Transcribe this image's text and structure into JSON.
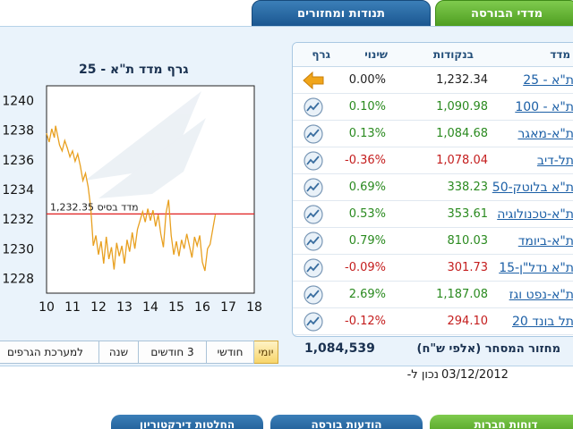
{
  "tabs": {
    "indices": "מדדי הבורסה",
    "movements": "תנודות ומחזורים"
  },
  "chart": {
    "title": "גרף מדד ת\"א - 25",
    "base_label": "מדד בסיס 1,232.35"
  },
  "chart_data": {
    "type": "line",
    "title": "גרף מדד ת\"א - 25",
    "x_ticks": [
      10,
      11,
      12,
      13,
      14,
      15,
      16,
      17,
      18
    ],
    "y_ticks": [
      1228,
      1230,
      1232,
      1234,
      1236,
      1238,
      1240
    ],
    "ylim": [
      1227,
      1241
    ],
    "xlim": [
      10,
      18
    ],
    "base_value": 1232.35,
    "series": [
      {
        "x": [
          10.0,
          10.1,
          10.2,
          10.3,
          10.35,
          10.5,
          10.6,
          10.7,
          10.8,
          10.9,
          11.0,
          11.1,
          11.2,
          11.3,
          11.4,
          11.5,
          11.6,
          11.7,
          11.8,
          11.9,
          12.0,
          12.1,
          12.2,
          12.3,
          12.4,
          12.5,
          12.6,
          12.7,
          12.8,
          12.9,
          13.0,
          13.1,
          13.2,
          13.3,
          13.4,
          13.5,
          13.6,
          13.7,
          13.8,
          13.9,
          14.0,
          14.1,
          14.2,
          14.3,
          14.4,
          14.5,
          14.6,
          14.7,
          14.8,
          14.9,
          15.0,
          15.1,
          15.2,
          15.3,
          15.4,
          15.5,
          15.6,
          15.7,
          15.8,
          15.9,
          16.0,
          16.1,
          16.2,
          16.3,
          16.4,
          16.5
        ],
        "values": [
          1237.8,
          1237.2,
          1238.1,
          1237.5,
          1238.3,
          1237.0,
          1236.6,
          1237.3,
          1236.8,
          1236.2,
          1236.6,
          1235.9,
          1236.4,
          1235.6,
          1234.6,
          1235.1,
          1234.2,
          1232.8,
          1230.2,
          1230.9,
          1229.6,
          1230.5,
          1229.0,
          1230.8,
          1229.3,
          1230.1,
          1228.6,
          1230.4,
          1229.5,
          1230.2,
          1229.0,
          1230.6,
          1229.8,
          1231.1,
          1230.0,
          1231.3,
          1231.9,
          1232.5,
          1231.8,
          1232.7,
          1231.9,
          1232.6,
          1231.5,
          1232.3,
          1231.0,
          1230.1,
          1232.4,
          1233.3,
          1230.9,
          1229.6,
          1230.5,
          1229.5,
          1230.6,
          1230.0,
          1231.0,
          1230.2,
          1229.4,
          1230.8,
          1230.2,
          1230.9,
          1229.1,
          1228.5,
          1230.0,
          1230.3,
          1231.3,
          1232.3
        ]
      }
    ]
  },
  "table": {
    "headers": {
      "name": "מדד",
      "points": "בנקודות",
      "change": "שינוי",
      "chart": "גרף"
    },
    "rows": [
      {
        "name": "ת\"א - 25",
        "points": "1,232.34",
        "change": "0.00%",
        "dir": "zero"
      },
      {
        "name": "ת\"א - 100",
        "points": "1,090.98",
        "change": "0.10%",
        "dir": "pos"
      },
      {
        "name": "ת\"א-מאגר",
        "points": "1,084.68",
        "change": "0.13%",
        "dir": "pos"
      },
      {
        "name": "תל-דיב",
        "points": "1,078.04",
        "change": "-0.36%",
        "dir": "neg"
      },
      {
        "name": "ת\"א בלוטק-50",
        "points": "338.23",
        "change": "0.69%",
        "dir": "pos"
      },
      {
        "name": "ת\"א-טכנולוגיה",
        "points": "353.61",
        "change": "0.53%",
        "dir": "pos"
      },
      {
        "name": "ת\"א-ביומד",
        "points": "810.03",
        "change": "0.79%",
        "dir": "pos"
      },
      {
        "name": "ת\"א נדל\"ן-15",
        "points": "301.73",
        "change": "-0.09%",
        "dir": "neg"
      },
      {
        "name": "ת\"א-נפט וגז",
        "points": "1,187.08",
        "change": "2.69%",
        "dir": "pos"
      },
      {
        "name": "תל בונד 20",
        "points": "294.10",
        "change": "-0.12%",
        "dir": "neg"
      }
    ]
  },
  "volume": {
    "label": "מחזור המסחר (אלפי ש\"ח)",
    "value": "1,084,539"
  },
  "period_tabs": [
    "יומי",
    "חודשי",
    "3 חודשים",
    "שנה",
    "למערכת הגרפים"
  ],
  "date": {
    "label": "נכון ל-",
    "value": "03/12/2012"
  },
  "bottom_tabs": [
    "דוחות חברות",
    "הודעות בורסה",
    "החלטות דירקטוריון"
  ],
  "colors": {
    "positive": "#2a8a1f",
    "negative": "#c41d1d",
    "base_line": "#e02020",
    "series": "#e8a020"
  }
}
